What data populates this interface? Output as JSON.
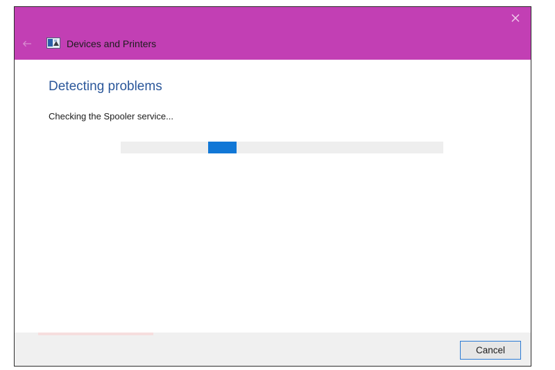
{
  "window": {
    "title": "Devices and Printers",
    "title_bar_color": "#c23fb4",
    "close_icon": "close-icon",
    "back_icon": "arrow-left-icon",
    "app_icon": "devices-and-printers-icon"
  },
  "main": {
    "heading": "Detecting problems",
    "status": "Checking the Spooler service...",
    "progress": {
      "mode": "indeterminate",
      "chunk_start_fraction": 0.27,
      "chunk_width_fraction": 0.09,
      "track_color": "#eeeeee",
      "fill_color": "#1177d6"
    }
  },
  "footer": {
    "cancel_label": "Cancel"
  }
}
